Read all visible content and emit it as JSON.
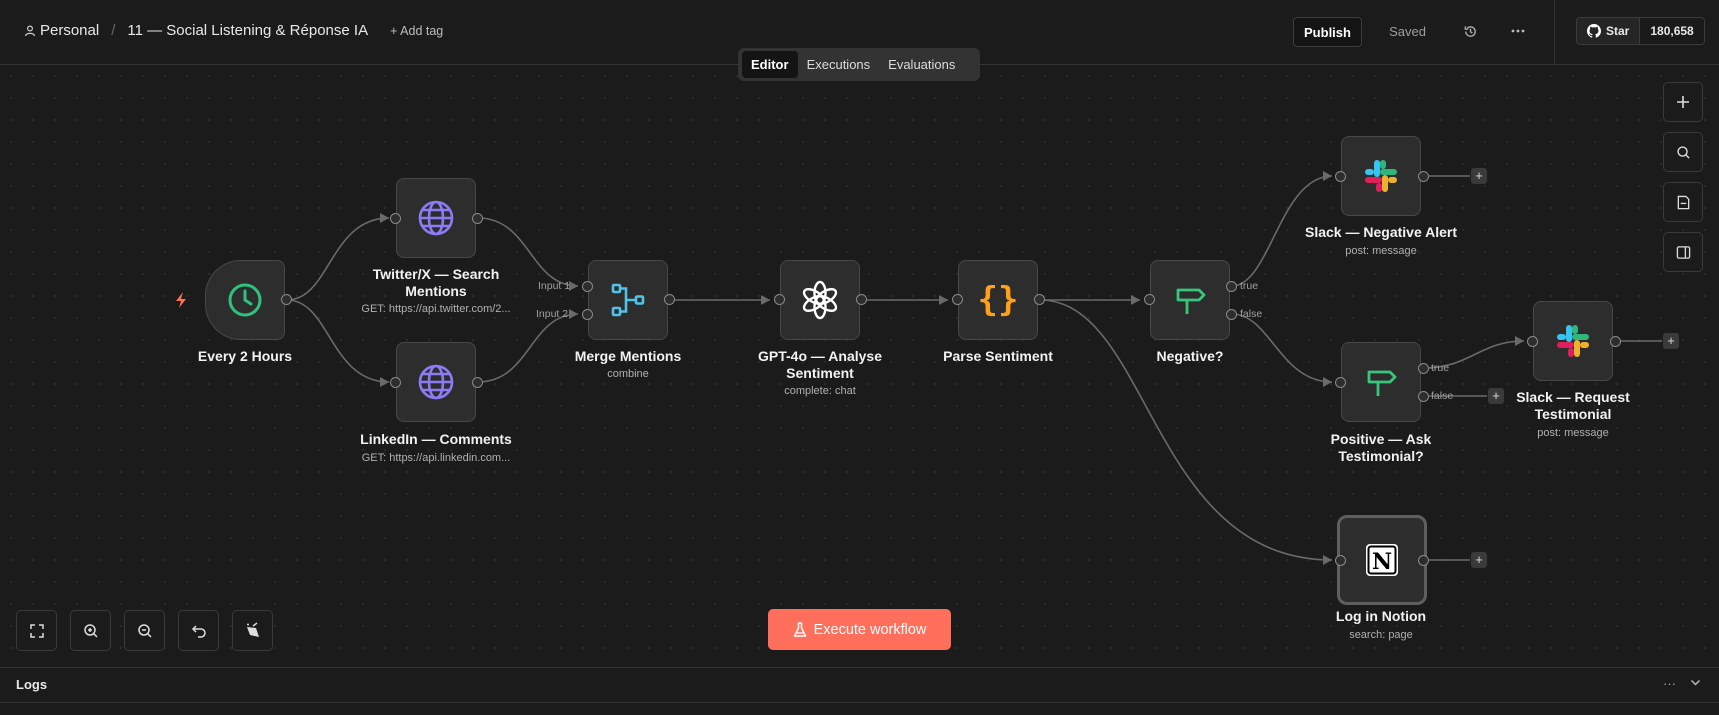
{
  "header": {
    "workspace": "Personal",
    "workflow_name": "11 — Social Listening & Réponse IA",
    "add_tag": "+ Add tag",
    "publish": "Publish",
    "saved": "Saved",
    "github_star": "Star",
    "github_count": "180,658"
  },
  "tabs": [
    "Editor",
    "Executions",
    "Evaluations"
  ],
  "nodes": {
    "every2h": {
      "label": "Every 2 Hours",
      "sub": ""
    },
    "twitter": {
      "label": "Twitter/X — Search Mentions",
      "sub": "GET: https://api.twitter.com/2..."
    },
    "linkedin": {
      "label": "LinkedIn — Comments",
      "sub": "GET: https://api.linkedin.com..."
    },
    "merge": {
      "label": "Merge Mentions",
      "sub": "combine",
      "input1": "Input 1",
      "input2": "Input 2"
    },
    "gpt": {
      "label": "GPT-4o — Analyse Sentiment",
      "sub": "complete: chat"
    },
    "parse": {
      "label": "Parse Sentiment",
      "sub": ""
    },
    "negative": {
      "label": "Negative?",
      "sub": "",
      "true_label": "true",
      "false_label": "false"
    },
    "slack_neg": {
      "label": "Slack — Negative Alert",
      "sub": "post: message"
    },
    "positive": {
      "label": "Positive — Ask Testimonial?",
      "sub": "",
      "true_label": "true",
      "false_label": "false"
    },
    "slack_req": {
      "label": "Slack — Request Testimonial",
      "sub": "post: message"
    },
    "notion": {
      "label": "Log in Notion",
      "sub": "search: page"
    }
  },
  "execute_button": "Execute workflow",
  "logs": {
    "title": "Logs"
  },
  "colors": {
    "accent": "#ff6f5c",
    "clock": "#2ec27e",
    "globe": "#8b7cf6",
    "merge": "#4fc3e8",
    "code": "#ff9f1a",
    "if": "#37c77a"
  }
}
